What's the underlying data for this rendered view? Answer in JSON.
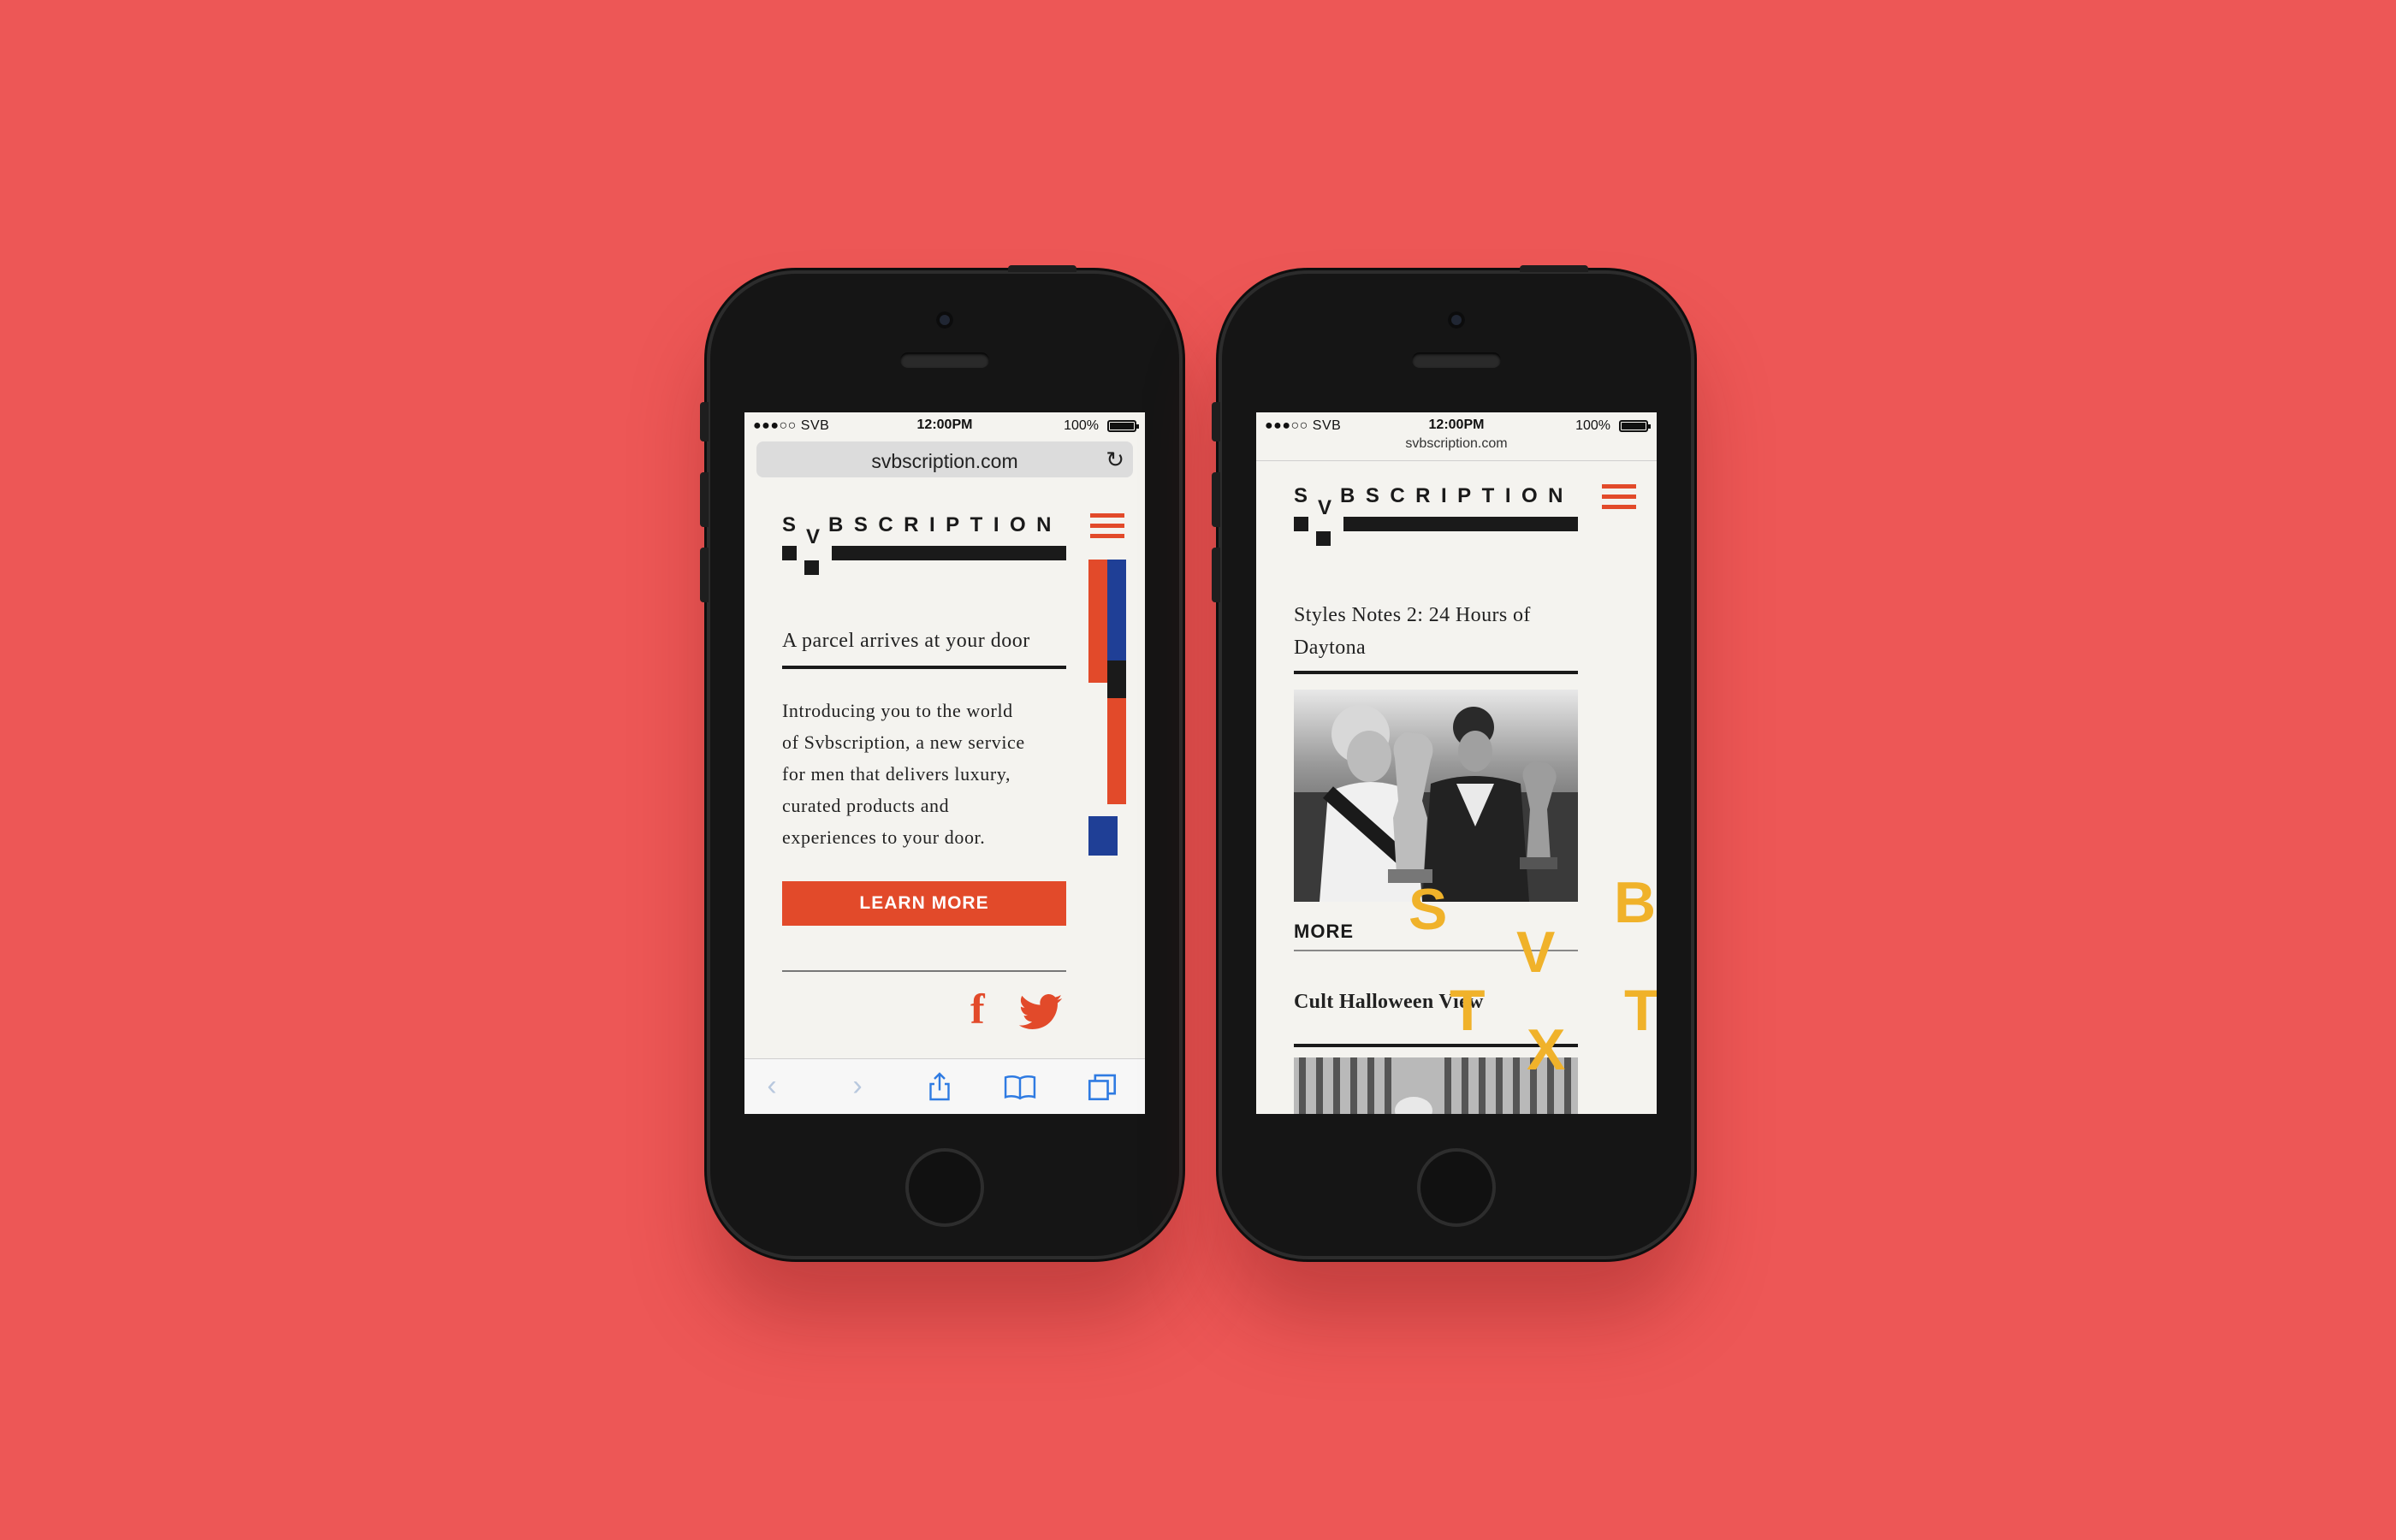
{
  "status": {
    "carrier": "●●●○○ SVB",
    "time": "12:00PM",
    "battery": "100%"
  },
  "left": {
    "url": "svbscription.com",
    "logo": {
      "s": "S",
      "v": "V",
      "rest": "BSCRIPTION"
    },
    "heading": "A parcel arrives at your door",
    "body_lines": [
      "Introducing you to the world",
      "of Svbscription, a new service",
      "for men that delivers luxury,",
      "curated products and",
      "experiences to your door."
    ],
    "cta_label": "LEARN MORE",
    "social": {
      "facebook": "f"
    }
  },
  "right": {
    "url": "svbscription.com",
    "logo": {
      "s": "S",
      "v": "V",
      "rest": "BSCRIPTION"
    },
    "article1_title_lines": [
      "Styles Notes 2: 24 Hours of",
      "Daytona"
    ],
    "more_label": "MORE",
    "article2_title": "Cult Halloween View",
    "deco_letters": {
      "s": "S",
      "b": "B",
      "v": "V",
      "t1": "T",
      "t2": "T",
      "x": "X"
    }
  },
  "colors": {
    "background": "#ed5756",
    "accent": "#e24a2a",
    "blue": "#1f3f96",
    "yellow": "#f0b22a"
  }
}
